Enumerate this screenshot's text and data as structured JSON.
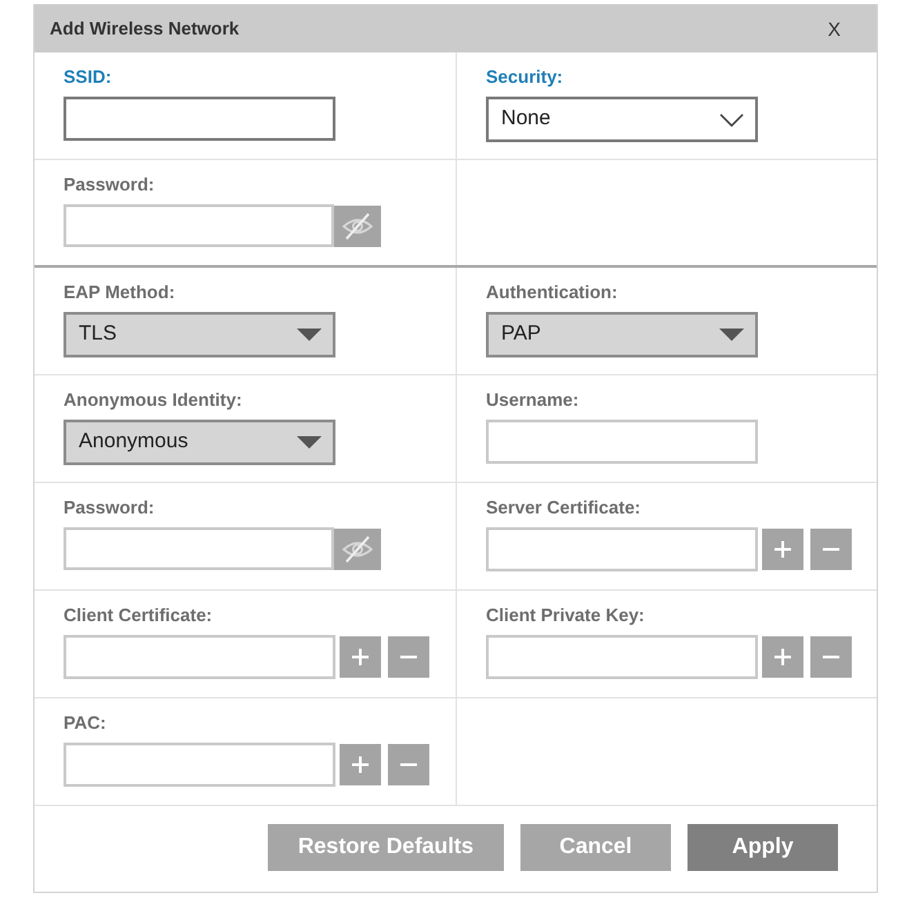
{
  "window": {
    "title": "Add Wireless Network",
    "close": "X"
  },
  "sections": [
    {
      "rows": [
        [
          {
            "kind": "text",
            "label": "SSID:",
            "disabled": false
          },
          {
            "kind": "select",
            "label": "Security:",
            "value": "None",
            "disabled": false
          }
        ],
        [
          {
            "kind": "password",
            "label": "Password:",
            "disabled": true
          },
          {
            "kind": "empty"
          }
        ]
      ]
    },
    {
      "rows": [
        [
          {
            "kind": "select",
            "label": "EAP Method:",
            "value": "TLS",
            "disabled": true
          },
          {
            "kind": "select",
            "label": "Authentication:",
            "value": "PAP",
            "disabled": true
          }
        ],
        [
          {
            "kind": "select",
            "label": "Anonymous Identity:",
            "value": "Anonymous",
            "disabled": true
          },
          {
            "kind": "text",
            "label": "Username:",
            "disabled": true
          }
        ],
        [
          {
            "kind": "password",
            "label": "Password:",
            "disabled": true
          },
          {
            "kind": "file",
            "label": "Server Certificate:",
            "disabled": true
          }
        ],
        [
          {
            "kind": "file",
            "label": "Client Certificate:",
            "disabled": true
          },
          {
            "kind": "file",
            "label": "Client Private Key:",
            "disabled": true
          }
        ],
        [
          {
            "kind": "file",
            "label": "PAC:",
            "disabled": true
          },
          {
            "kind": "empty"
          }
        ]
      ]
    }
  ],
  "buttons": [
    {
      "label": "Restore Defaults",
      "primary": false
    },
    {
      "label": "Cancel",
      "primary": false
    },
    {
      "label": "Apply",
      "primary": true
    }
  ]
}
